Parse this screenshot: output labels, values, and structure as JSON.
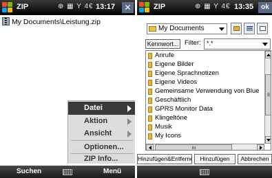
{
  "left_screen": {
    "titlebar": {
      "title": "ZIP",
      "status_icons": "⊕ ▦ Y 4€",
      "time": "13:17",
      "close_label": "✕"
    },
    "path": "My Documents\\Leistung.zip",
    "context_menu": {
      "items": [
        {
          "label": "Datei",
          "active": true,
          "submenu": true
        },
        {
          "label": "Aktion",
          "active": false,
          "submenu": true
        },
        {
          "label": "Ansicht",
          "active": false,
          "submenu": true
        },
        {
          "label": "Optionen...",
          "active": false,
          "submenu": false
        },
        {
          "label": "ZIP Info...",
          "active": false,
          "submenu": false
        }
      ]
    },
    "softkeys": {
      "left": "Suchen",
      "right": "Menü"
    }
  },
  "right_screen": {
    "titlebar": {
      "title": "ZIP",
      "status_icons": "⊕ ▦ Y 4€",
      "time": "13:35",
      "ok_label": "ok"
    },
    "folder_select": {
      "value": "My Documents"
    },
    "password_button": "Kennwort...",
    "filter": {
      "label": "Filter:",
      "value": "*.*"
    },
    "files": [
      "Anrufe",
      "Eigene Bilder",
      "Eigene Sprachnotizen",
      "Eigene Videos",
      "Gemeinsame Verwendung von Blue",
      "Geschäftlich",
      "GPRS Monitor Data",
      "Klingeltöne",
      "Musik",
      "My Icons"
    ],
    "actions": {
      "add_remove": "Hinzufügen&Entfernen",
      "add": "Hinzufügen",
      "cancel": "Abbrechen"
    }
  }
}
